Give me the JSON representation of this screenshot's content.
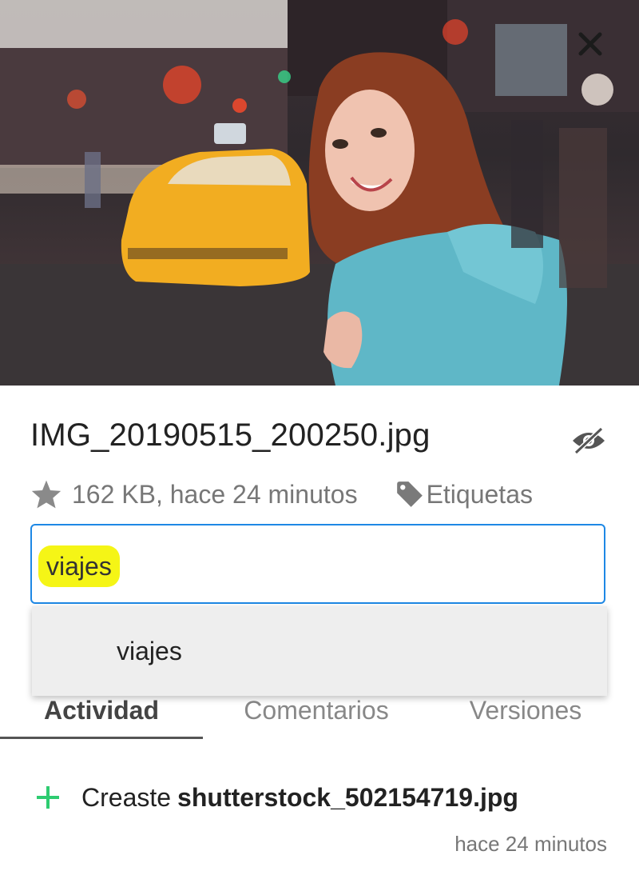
{
  "preview": {
    "close_icon": "close-icon"
  },
  "file": {
    "name": "IMG_20190515_200250.jpg",
    "meta": "162 KB, hace 24 minutos",
    "hide_icon": "eye-off-icon",
    "favorite_icon": "star-icon"
  },
  "tags": {
    "link_label": "Etiquetas",
    "icon": "tag-icon",
    "chip": "viajes",
    "suggestions": [
      "viajes"
    ]
  },
  "tabs": [
    {
      "label": "Actividad",
      "active": true
    },
    {
      "label": "Comentarios",
      "active": false
    },
    {
      "label": "Versiones",
      "active": false
    }
  ],
  "activity": {
    "action": "Creaste",
    "filename": "shutterstock_502154719.jpg",
    "time": "hace 24 minutos",
    "icon": "plus-icon"
  },
  "colors": {
    "input_border": "#1e88e5",
    "tag_highlight": "#f5f516",
    "plus_green": "#2ecc71"
  }
}
